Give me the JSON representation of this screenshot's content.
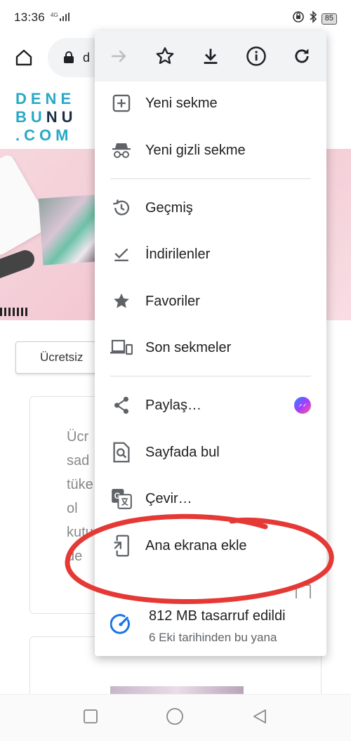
{
  "status_bar": {
    "time": "13:36",
    "network": "4G",
    "battery": "85"
  },
  "toolbar": {
    "url_fragment": "d"
  },
  "page": {
    "logo_line1": "DENE",
    "logo_line2": "BUNU",
    "logo_line3": ".COM",
    "chip_label": "Ücretsiz",
    "card_text": [
      "Ücr",
      "sad",
      "tüke",
      "ol",
      "kutu",
      "de"
    ]
  },
  "menu": {
    "actions": [
      {
        "icon": "forward-arrow-icon",
        "enabled": false
      },
      {
        "icon": "star-outline-icon",
        "enabled": true
      },
      {
        "icon": "download-icon",
        "enabled": true
      },
      {
        "icon": "info-icon",
        "enabled": true
      },
      {
        "icon": "refresh-icon",
        "enabled": true
      }
    ],
    "items": [
      {
        "label": "Yeni sekme",
        "icon": "new-tab-icon"
      },
      {
        "label": "Yeni gizli sekme",
        "icon": "incognito-icon"
      },
      {
        "label": "Geçmiş",
        "icon": "history-icon"
      },
      {
        "label": "İndirilenler",
        "icon": "downloads-check-icon"
      },
      {
        "label": "Favoriler",
        "icon": "star-filled-icon"
      },
      {
        "label": "Son sekmeler",
        "icon": "devices-icon"
      },
      {
        "label": "Paylaş…",
        "icon": "share-icon"
      },
      {
        "label": "Sayfada bul",
        "icon": "find-in-page-icon"
      },
      {
        "label": "Çevir…",
        "icon": "translate-icon"
      },
      {
        "label": "Ana ekrana ekle",
        "icon": "add-to-home-icon"
      }
    ],
    "savings": {
      "title": "812 MB tasarruf edildi",
      "subtitle": "6 Eki tarihinden bu yana"
    }
  },
  "colors": {
    "accent": "#1a73e8",
    "annotation": "#e53935",
    "icon": "#5f6368",
    "logo_blue": "#27a9c6",
    "logo_dark": "#1d2d44"
  }
}
